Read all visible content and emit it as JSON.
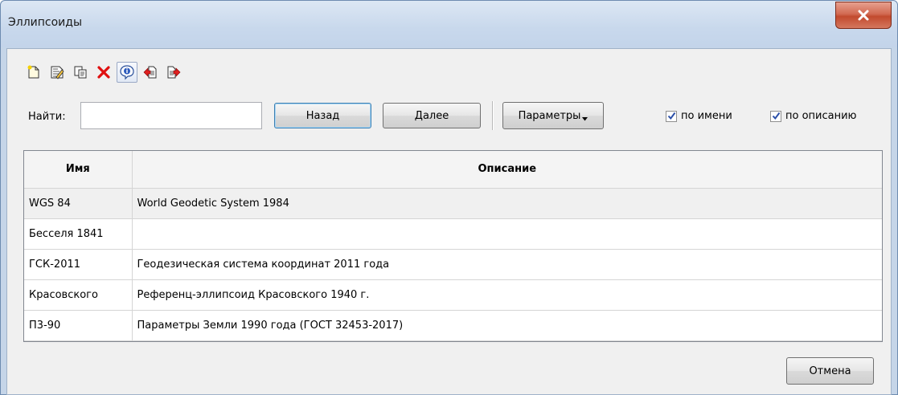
{
  "window": {
    "title": "Эллипсоиды",
    "close_icon": "close-x-icon"
  },
  "toolbar": {
    "buttons": [
      {
        "name": "new-icon",
        "pressed": false
      },
      {
        "name": "edit-icon",
        "pressed": false
      },
      {
        "name": "copy-icon",
        "pressed": false
      },
      {
        "name": "delete-icon",
        "pressed": false
      },
      {
        "name": "info-icon",
        "pressed": true
      },
      {
        "name": "import-icon",
        "pressed": false
      },
      {
        "name": "export-icon",
        "pressed": false
      }
    ]
  },
  "search": {
    "label": "Найти:",
    "value": "",
    "back_label": "Назад",
    "next_label": "Далее",
    "params_label": "Параметры",
    "by_name_label": "по имени",
    "by_name_checked": true,
    "by_desc_label": "по описанию",
    "by_desc_checked": true
  },
  "table": {
    "columns": [
      "Имя",
      "Описание"
    ],
    "rows": [
      {
        "name": "WGS 84",
        "description": "World Geodetic System 1984",
        "selected": true
      },
      {
        "name": "Бесселя 1841",
        "description": "",
        "selected": false
      },
      {
        "name": "ГСК-2011",
        "description": "Геодезическая система координат 2011 года",
        "selected": false
      },
      {
        "name": "Красовского",
        "description": "Референц-эллипсоид Красовского 1940 г.",
        "selected": false
      },
      {
        "name": "П3-90",
        "description": "Параметры Земли 1990 года (ГОСТ 32453-2017)",
        "selected": false
      }
    ]
  },
  "footer": {
    "cancel_label": "Отмена"
  },
  "colors": {
    "titlebar": "#c8d8ec",
    "close_button": "#c24a2e",
    "client_bg": "#f0f0f0",
    "default_button_border": "#3c7fb1"
  }
}
